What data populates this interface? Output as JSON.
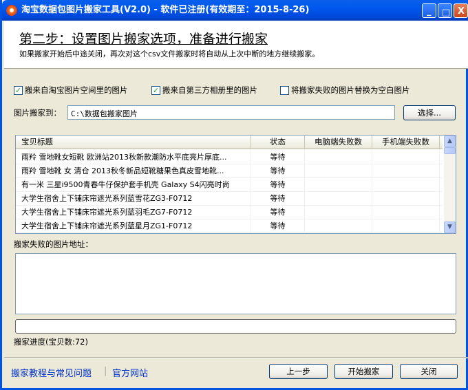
{
  "window": {
    "title": "淘宝数据包图片搬家工具(V2.0) - 软件已注册(有效期至：2015-8-26)",
    "minimize": "_",
    "maximize": "□",
    "close": "X"
  },
  "header": {
    "title": "第二步：设置图片搬家选项，准备进行搬家",
    "subtitle": "如果搬家开始后中途关闭，再次对这个csv文件搬家时将自动从上次中断的地方继续搬家。"
  },
  "options": [
    {
      "label": "搬来自淘宝图片空间里的图片",
      "checked": true
    },
    {
      "label": "搬来自第三方相册里的图片",
      "checked": true
    },
    {
      "label": "将搬家失败的图片替换为空白图片",
      "checked": false
    }
  ],
  "path": {
    "label": "图片搬家到：",
    "value": "C:\\数据包搬家图片",
    "browse": "选择..."
  },
  "table": {
    "columns": [
      "宝贝标题",
      "状态",
      "电脑端失败数",
      "手机端失败数"
    ],
    "rows": [
      [
        "雨羚 雪地靴女短靴 欧洲站2013秋新款潮防水平底亮片厚底...",
        "等待",
        "",
        ""
      ],
      [
        "雨羚 雪地靴 女 清仓 2013秋冬新品短靴糖果色真皮雪地靴...",
        "等待",
        "",
        ""
      ],
      [
        "有一米 三星i9500青春牛仔保护套手机壳 Galaxy S4闪亮时尚",
        "等待",
        "",
        ""
      ],
      [
        "大学生宿舍上下铺床帘遮光系列蓝雪花ZG3-F0712",
        "等待",
        "",
        ""
      ],
      [
        "大学生宿舍上下铺床帘遮光系列蓝羽毛ZG7-F0712",
        "等待",
        "",
        ""
      ],
      [
        "大学生宿舍上下铺床帘遮光系列蓝星月ZG1-F0712",
        "等待",
        "",
        ""
      ]
    ]
  },
  "failed": {
    "label": "搬家失败的图片地址：",
    "value": ""
  },
  "progress": {
    "label": "搬家进度(宝贝数:72)",
    "percent": 0
  },
  "footer": {
    "help_link": "搬家教程与常见问题",
    "site_link": "官方网站",
    "separator": "|",
    "prev": "上一步",
    "start": "开始搬家",
    "close": "关闭"
  }
}
